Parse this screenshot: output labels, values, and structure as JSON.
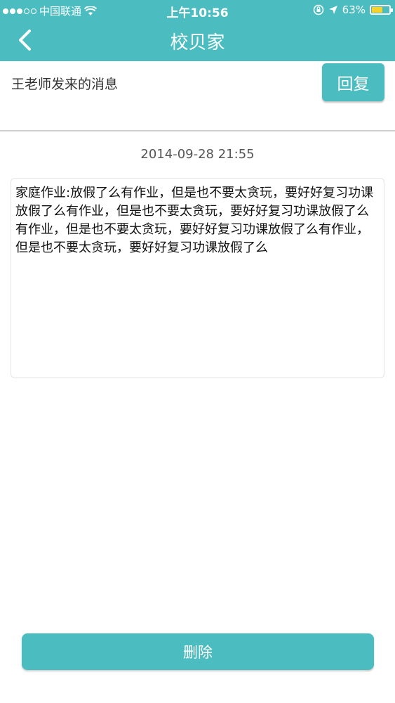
{
  "status_bar": {
    "carrier": "中国联通",
    "time": "上午10:56",
    "battery_percent": "63%",
    "battery_level": 0.63,
    "icons": [
      "signal-dots-icon",
      "wifi-icon",
      "orientation-lock-icon",
      "location-arrow-icon",
      "battery-icon"
    ]
  },
  "nav": {
    "title": "校贝家",
    "back_icon": "chevron-left-icon"
  },
  "message": {
    "sender_label": "王老师发来的消息",
    "reply_label": "回复",
    "timestamp": "2014-09-28 21:55",
    "body": "家庭作业:放假了么有作业，但是也不要太贪玩，要好好复习功课放假了么有作业，但是也不要太贪玩，要好好复习功课放假了么有作业，但是也不要太贪玩，要好好复习功课放假了么有作业，但是也不要太贪玩，要好好复习功课放假了么"
  },
  "actions": {
    "delete_label": "删除"
  },
  "colors": {
    "accent": "#4bbdc0",
    "battery": "#f7d12d"
  }
}
